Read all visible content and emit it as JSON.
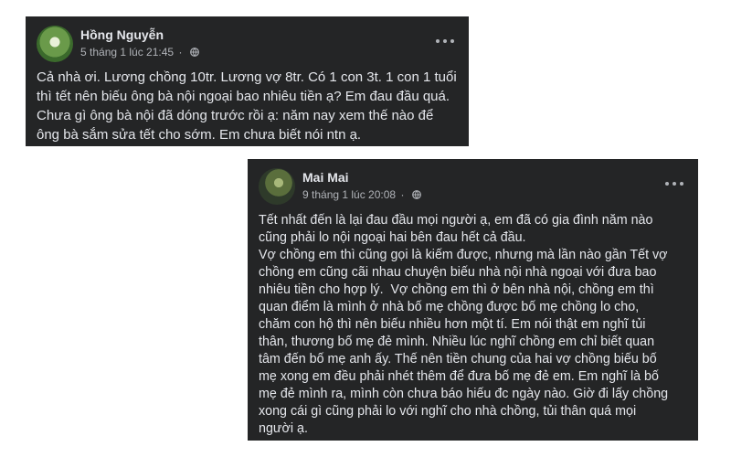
{
  "posts": [
    {
      "author": "Hồng Nguyễn",
      "timestamp": "5 tháng 1 lúc 21:45",
      "separator": "·",
      "privacy_icon": "globe-icon",
      "text": "Cả nhà ơi. Lương chồng 10tr. Lương vợ 8tr. Có 1 con 3t. 1 con 1 tuổi\nthì tết nên biếu ông bà nội ngoại bao nhiêu tiền ạ? Em đau đầu quá.\nChưa gì ông bà nội đã dóng trước rồi ạ: năm nay xem thế nào để\nông bà sắm sửa tết cho sớm. Em chưa biết nói ntn ạ."
    },
    {
      "author": "Mai Mai",
      "timestamp": "9 tháng 1 lúc 20:08",
      "separator": "·",
      "privacy_icon": "globe-icon",
      "text": "Tết nhất đến là lại đau đầu mọi người ạ, em đã có gia đình năm nào\ncũng phải lo nội ngoại hai bên đau hết cả đầu.\nVợ chồng em thì cũng gọi là kiếm được, nhưng mà lần nào gần Tết vợ\nchồng em cũng cãi nhau chuyện biếu nhà nội nhà ngoại với đưa bao\nnhiêu tiền cho hợp lý.  Vợ chồng em thì ở bên nhà nội, chồng em thì\nquan điểm là mình ở nhà bố mẹ chồng được bố mẹ chồng lo cho,\nchăm con hộ thì nên biếu nhiều hơn một tí. Em nói thật em nghĩ tủi\nthân, thương bố mẹ đẻ mình. Nhiều lúc nghĩ chồng em chỉ biết quan\ntâm đến bố mẹ anh ấy. Thế nên tiền chung của hai vợ chồng biếu bố\nmẹ xong em đều phải nhét thêm để đưa bố mẹ đẻ em. Em nghĩ là bố\nmẹ đẻ mình ra, mình còn chưa báo hiếu đc ngày nào. Giờ đi lấy chồng\nxong cái gì cũng phải lo với nghĩ cho nhà chồng, tủi thân quá mọi\nngười ạ."
    }
  ],
  "colors": {
    "card_bg": "#242526",
    "text_primary": "#e4e6eb",
    "text_secondary": "#b0b3b8",
    "page_bg": "#ffffff"
  }
}
